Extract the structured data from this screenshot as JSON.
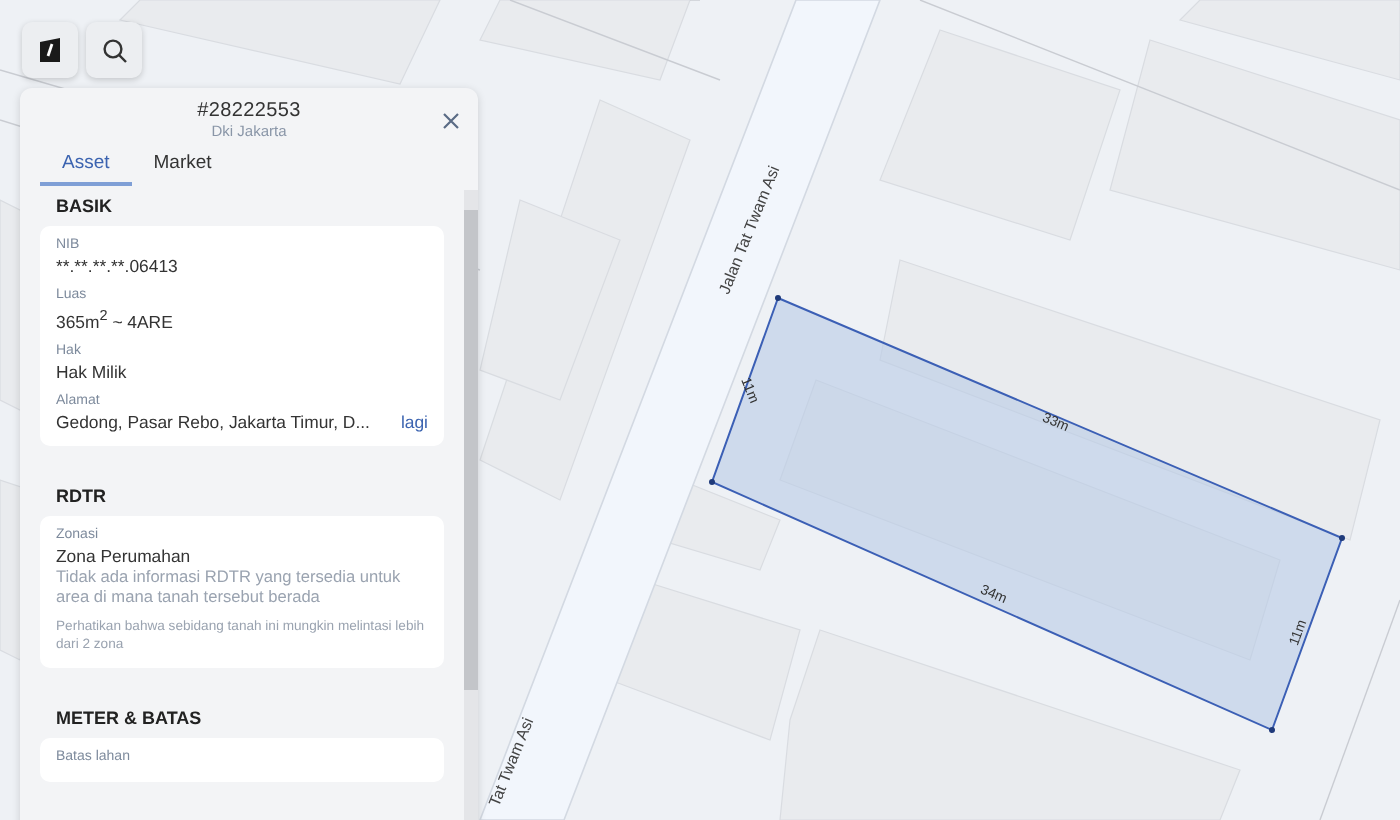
{
  "map": {
    "road_labels": [
      "Jalan Tat Twam Asi",
      "Tat Twam Asi"
    ],
    "edge_labels": [
      "11m",
      "33m",
      "11m",
      "34m"
    ]
  },
  "panel": {
    "title": "#28222553",
    "subtitle": "Dki Jakarta",
    "tabs": [
      {
        "label": "Asset",
        "selected": true
      },
      {
        "label": "Market",
        "selected": false
      }
    ],
    "sections": [
      {
        "heading": "BASIK",
        "fields": [
          {
            "kind": "text",
            "label": "NIB",
            "value": "**.**.**.**.06413"
          },
          {
            "kind": "area",
            "label": "Luas",
            "value": "365m$^{2}$ ~ 4ARE"
          },
          {
            "kind": "text",
            "label": "Hak",
            "value": "Hak Milik"
          },
          {
            "kind": "text",
            "label": "Alamat",
            "value": "Gedong, Pasar Rebo, Jakarta Timur, D...",
            "link": "lagi"
          }
        ]
      },
      {
        "heading": "RDTR",
        "fields": [
          {
            "kind": "text",
            "label": "Zonasi",
            "value": "Zona Perumahan",
            "description": "Tidak ada informasi RDTR yang tersedia untuk area di mana tanah tersebut berada"
          }
        ],
        "note": "Perhatikan bahwa sebidang tanah ini mungkin melintasi lebih dari 2 zona"
      },
      {
        "heading": "METER & BATAS",
        "fields": [
          {
            "label": "Batas lahan"
          }
        ]
      }
    ]
  }
}
